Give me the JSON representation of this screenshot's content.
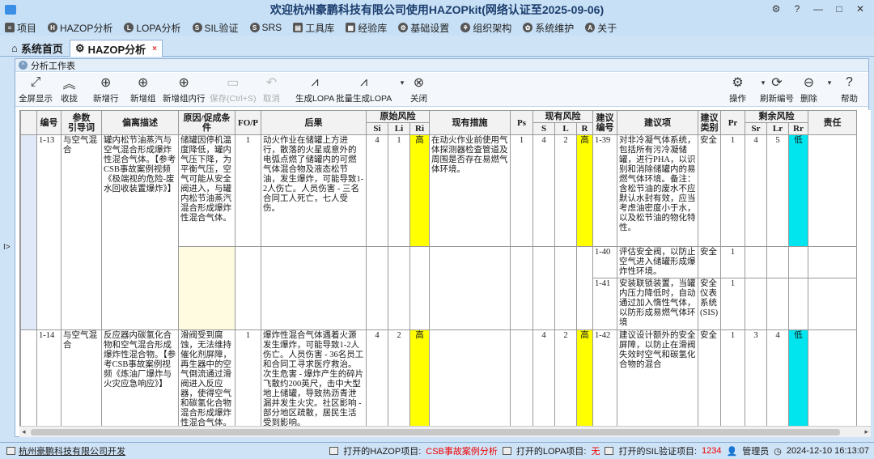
{
  "window": {
    "title": "欢迎杭州豪鹏科技有限公司使用HAZOPkit(网络认证至2025-09-06)",
    "controls": [
      "⚙",
      "?",
      "—",
      "□",
      "✕"
    ]
  },
  "menu": [
    {
      "label": "项目",
      "icon": "≡"
    },
    {
      "label": "HAZOP分析",
      "icon": "H"
    },
    {
      "label": "LOPA分析",
      "icon": "L"
    },
    {
      "label": "SIL验证",
      "icon": "S"
    },
    {
      "label": "SRS",
      "icon": "S"
    },
    {
      "label": "工具库",
      "icon": "▤"
    },
    {
      "label": "经验库",
      "icon": "▦"
    },
    {
      "label": "基础设置",
      "icon": "⚙"
    },
    {
      "label": "组织架构",
      "icon": "⚘"
    },
    {
      "label": "系统维护",
      "icon": "✿"
    },
    {
      "label": "关于",
      "icon": "A"
    }
  ],
  "tabs": {
    "home": "系统首页",
    "active": "HAZOP分析",
    "close": "×"
  },
  "panel": {
    "title": "分析工作表"
  },
  "toolbar": {
    "fullscreen": "全屏显示",
    "collapse": "收拢",
    "add_row": "新增行",
    "add_group": "新增组",
    "add_group_row": "新增组内行",
    "save": "保存(Ctrl+S)",
    "cancel": "取消",
    "gen_lopa": "生成LOPA",
    "batch_lopa": "批量生成LOPA",
    "close": "关闭",
    "operate": "操作",
    "renumber": "刷新编号",
    "delete": "删除",
    "help": "帮助"
  },
  "grid": {
    "headers": {
      "no": "编号",
      "param": "参数\n引导词",
      "deviation": "偏离描述",
      "cause": "原因/促成条件",
      "fop": "FO/P",
      "consequence": "后果",
      "orig_risk": "原始风险",
      "si": "Si",
      "li": "Li",
      "ri": "Ri",
      "measures": "现有措施",
      "ps": "Ps",
      "curr_risk": "现有风险",
      "s": "S",
      "l": "L",
      "r": "R",
      "rec_no": "建议\n编号",
      "rec": "建议项",
      "rec_type": "建议\n类别",
      "pr": "Pr",
      "resid_risk": "剩余风险",
      "sr": "Sr",
      "lr": "Lr",
      "rr": "Rr",
      "owner": "责任"
    },
    "rows": [
      {
        "no": "1-13",
        "param": "与空气混合",
        "deviation": "罐内松节油蒸汽与空气混合形成爆炸性混合气体。【参考CSB事故案例视频《极端视的危险-废水回收装置爆炸》】",
        "cause": "储罐因停机温度降低，罐内气压下降，为平衡气压，空气可能从安全阀进入，与罐内松节油蒸汽混合形成爆炸性混合气体。",
        "fop": "1",
        "consequence": "动火作业在储罐上方进行，散落的火星或意外的电弧点燃了储罐内的可燃气体混合物及液态松节油，发生爆炸，可能导致1-2人伤亡。人员伤害 - 三名合同工人死亡，七人受伤。",
        "si": "4",
        "li": "1",
        "ri": "高",
        "measures": "在动火作业前使用气体探测器检查管道及周围是否存在易燃气体环境。",
        "ps": "1",
        "s": "4",
        "l": "2",
        "r": "高",
        "recs": [
          {
            "no": "1-39",
            "text": "对非冷凝气体系统，包括所有污冷凝储罐，进行PHA，以识别和消除储罐内的易燃气体环境。备注：含松节油的废水不应默认水封有效，应当考虑油密度小于水，以及松节油的物化特性。",
            "type": "安全",
            "pr": "1",
            "sr": "4",
            "lr": "5",
            "rr": "低"
          },
          {
            "no": "1-40",
            "text": "评估安全阀，以防止空气进入储罐形成爆炸性环境。",
            "type": "安全",
            "pr": "1",
            "sr": "",
            "lr": "",
            "rr": ""
          },
          {
            "no": "1-41",
            "text": "安装联锁装置，当罐内压力降低时，自动通过加入惰性气体，以防形成易燃气体环境",
            "type": "安全仪表系统(SIS)",
            "pr": "1",
            "sr": "",
            "lr": "",
            "rr": ""
          }
        ]
      },
      {
        "no": "1-14",
        "param": "与空气混合",
        "deviation": "反应器内碳氢化合物和空气混合形成爆炸性混合物。【参考CSB事故案例视频《炼油厂爆炸与火灾应急响应》】",
        "cause": "滑阀受到腐蚀，无法维持催化剂屏障，再生器中的空气倒流通过滑阀进入反应器，使得空气和碳氢化合物混合形成爆炸性混合气体。",
        "fop": "1",
        "consequence": "爆炸性混合气体遇着火源发生爆炸，可能导致1-2人伤亡。人员伤害 - 36名员工和合同工寻求医疗救治。次生危害 - 爆炸产生的碎片飞散约200英尺，击中大型地上储罐，导致热沥青泄漏并发生火灾。社区影响 - 部分地区疏散，居民生活受到影响。",
        "si": "4",
        "li": "2",
        "ri": "高",
        "measures": "",
        "ps": "",
        "s": "4",
        "l": "2",
        "r": "高",
        "recs": [
          {
            "no": "1-42",
            "text": "建议设计额外的安全屏障，以防止在滑阀失效时空气和碳氢化合物的混合",
            "type": "安全",
            "pr": "1",
            "sr": "3",
            "lr": "4",
            "rr": "低"
          }
        ]
      }
    ]
  },
  "status": {
    "company": "杭州豪鹏科技有限公司开发",
    "hazop_label": "打开的HAZOP项目:",
    "hazop_value": "CSB事故案例分析",
    "lopa_label": "打开的LOPA项目:",
    "lopa_value": "无",
    "sil_label": "打开的SIL验证项目:",
    "sil_value": "1234",
    "user": "管理员",
    "datetime": "2024-12-10 16:13:07"
  },
  "colors": {
    "risk_high": "#ffff00",
    "risk_low": "#00e5ee",
    "accent": "#cfe3f6"
  }
}
